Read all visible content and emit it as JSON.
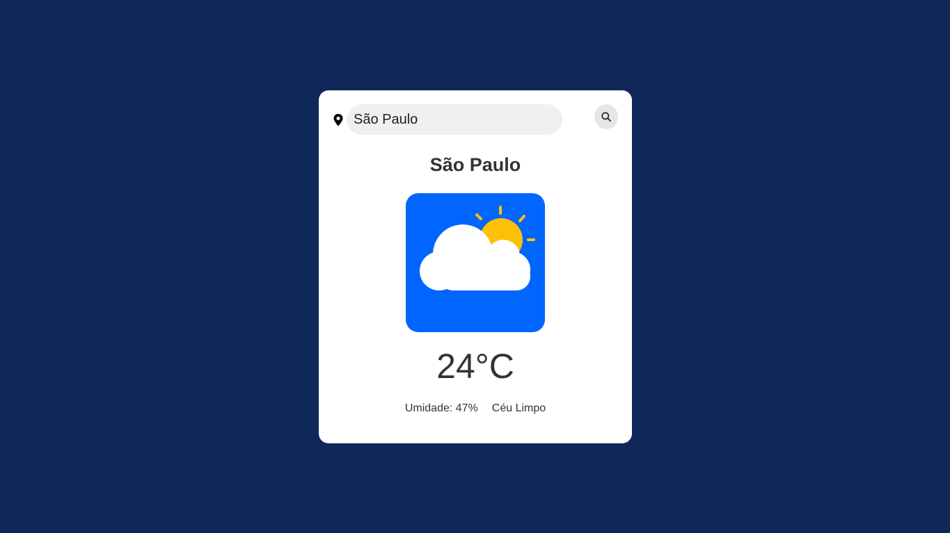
{
  "search": {
    "value": "São Paulo",
    "placeholder": ""
  },
  "weather": {
    "city": "São Paulo",
    "temperature": "24°C",
    "humidity": "Umidade: 47%",
    "description": "Céu Limpo",
    "icon": "partly-cloudy-icon"
  },
  "colors": {
    "background": "#102759",
    "card": "#ffffff",
    "icon_background": "#0066ff",
    "sun": "#ffc107",
    "cloud": "#ffffff"
  }
}
